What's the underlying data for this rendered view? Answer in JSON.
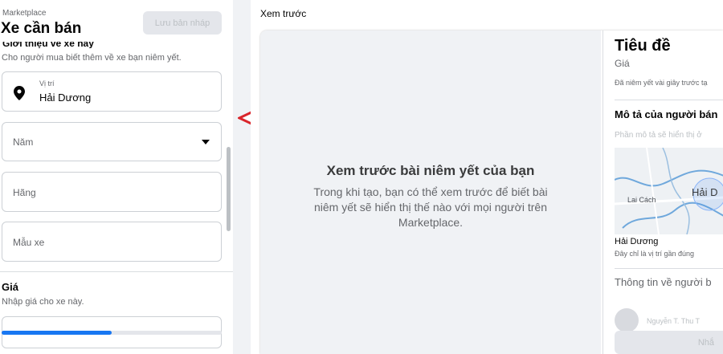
{
  "left_panel": {
    "breadcrumb": "Marketplace",
    "title": "Xe cần bán",
    "save_draft_label": "Lưu bản nháp",
    "about_heading_cut": "Giới thiệu về xe này",
    "about_helper": "Cho người mua biết thêm về xe bạn niêm yết.",
    "location": {
      "label": "Vị trí",
      "value": "Hải Dương"
    },
    "year_placeholder": "Năm",
    "make_placeholder": "Hãng",
    "model_placeholder": "Mẫu xe",
    "price_heading": "Giá",
    "price_helper": "Nhập giá cho xe này.",
    "progress_fraction": 0.5
  },
  "preview": {
    "header": "Xem trước",
    "title": "Xem trước bài niêm yết của bạn",
    "description": "Trong khi tạo, bạn có thể xem trước để biết bài niêm yết sẽ hiển thị thế nào với mọi người trên Marketplace."
  },
  "detail": {
    "title": "Tiêu đề",
    "price": "Giá",
    "listed_note": "Đã niêm yết vài giây trước tạ",
    "seller_description_heading": "Mô tả của người bán",
    "seller_description_placeholder": "Phần mô tả sẽ hiển thị ở",
    "map_label_lai_cach": "Lai Cách",
    "map_label_city": "Hải D",
    "location": "Hải Dương",
    "location_note": "Đây chỉ là vị trí gần đúng",
    "seller_info_heading": "Thông tin về người b",
    "seller_name": "Nguyễn T. Thu T",
    "message_button": "Nhắ"
  },
  "colors": {
    "accent": "#1877f2",
    "arrow": "#d9262c",
    "panel_bg": "#f0f2f5"
  }
}
